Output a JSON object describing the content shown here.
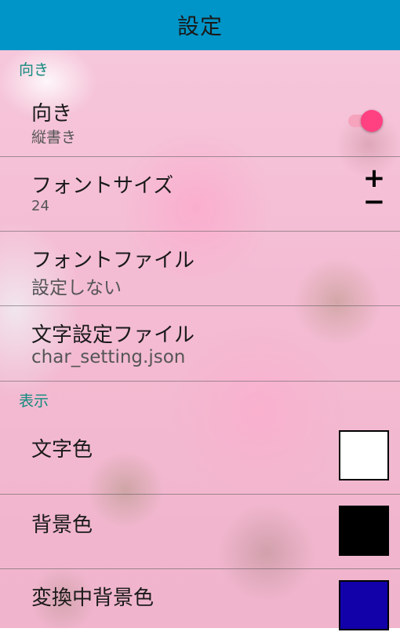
{
  "appbar": {
    "title": "設定"
  },
  "sections": {
    "orientation": {
      "header": "向き"
    },
    "display": {
      "header": "表示"
    }
  },
  "settings": {
    "orientation": {
      "label": "向き",
      "value": "縦書き",
      "switch_on": true
    },
    "font_size": {
      "label": "フォントサイズ",
      "value": "24",
      "plus": "+",
      "minus": "−"
    },
    "font_file": {
      "label": "フォントファイル",
      "value": "設定しない"
    },
    "char_setting_file": {
      "label": "文字設定ファイル",
      "value": "char_setting.json"
    },
    "text_color": {
      "label": "文字色",
      "color": "#ffffff"
    },
    "background_color": {
      "label": "背景色",
      "color": "#000000"
    },
    "converting_background_color": {
      "label": "変換中背景色",
      "color": "#1200a8"
    }
  },
  "colors": {
    "appbar": "#0095c8",
    "section_header": "#138a7e",
    "switch_thumb": "#ff4081",
    "switch_track": "#f6a3bd"
  }
}
